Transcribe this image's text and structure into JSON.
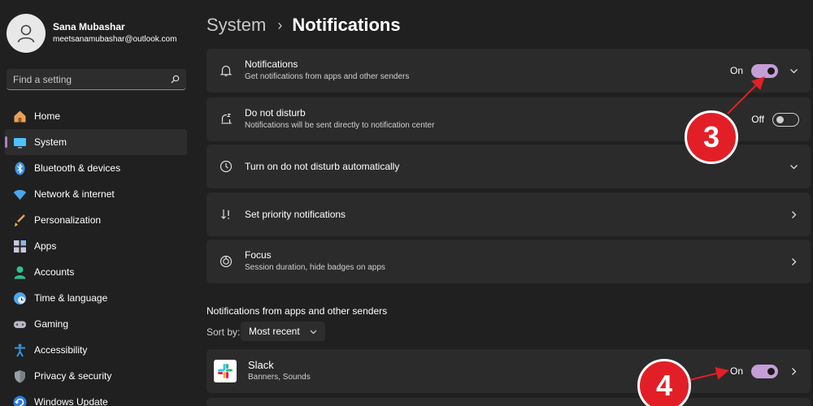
{
  "user": {
    "name": "Sana Mubashar",
    "email": "meetsanamubashar@outlook.com"
  },
  "search": {
    "placeholder": "Find a setting"
  },
  "nav": [
    {
      "label": "Home",
      "icon": "home-icon"
    },
    {
      "label": "System",
      "icon": "system-icon",
      "active": true
    },
    {
      "label": "Bluetooth & devices",
      "icon": "bluetooth-icon"
    },
    {
      "label": "Network & internet",
      "icon": "wifi-icon"
    },
    {
      "label": "Personalization",
      "icon": "brush-icon"
    },
    {
      "label": "Apps",
      "icon": "apps-icon"
    },
    {
      "label": "Accounts",
      "icon": "accounts-icon"
    },
    {
      "label": "Time & language",
      "icon": "clock-globe-icon"
    },
    {
      "label": "Gaming",
      "icon": "gamepad-icon"
    },
    {
      "label": "Accessibility",
      "icon": "accessibility-icon"
    },
    {
      "label": "Privacy & security",
      "icon": "shield-icon"
    },
    {
      "label": "Windows Update",
      "icon": "update-icon"
    }
  ],
  "breadcrumb": {
    "parent": "System",
    "separator": "›",
    "current": "Notifications"
  },
  "cards": {
    "notifications": {
      "title": "Notifications",
      "subtitle": "Get notifications from apps and other senders",
      "state": "On"
    },
    "dnd": {
      "title": "Do not disturb",
      "subtitle": "Notifications will be sent directly to notification center",
      "state": "Off"
    },
    "auto_dnd": {
      "title": "Turn on do not disturb automatically"
    },
    "priority": {
      "title": "Set priority notifications"
    },
    "focus": {
      "title": "Focus",
      "subtitle": "Session duration, hide badges on apps"
    }
  },
  "senders": {
    "section_title": "Notifications from apps and other senders",
    "sort_label": "Sort by:",
    "sort_value": "Most recent",
    "apps": [
      {
        "name": "Slack",
        "subtitle": "Banners, Sounds",
        "state": "On"
      }
    ]
  },
  "annotations": {
    "step3": "3",
    "step4": "4"
  },
  "colors": {
    "accent": "#c69ed6",
    "annotation": "#e21f26",
    "background": "#202020",
    "card": "#2b2b2b"
  }
}
